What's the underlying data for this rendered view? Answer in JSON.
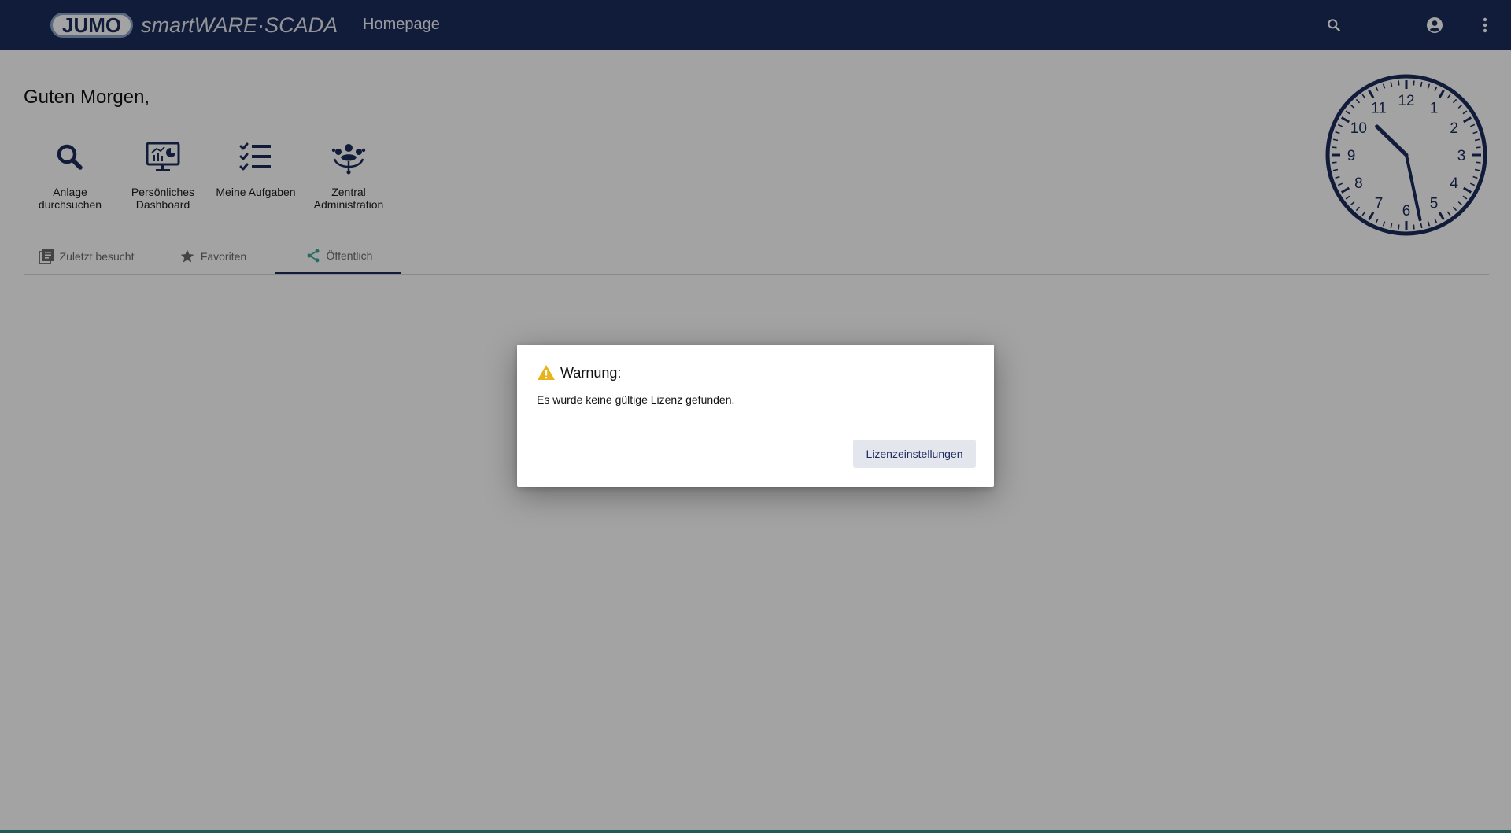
{
  "colors": {
    "topbar": "#1c2c5c",
    "accent": "#1c2c5c",
    "tab_active_icon": "#3aa89c",
    "warning": "#e8b31b",
    "overlay": "rgba(0,0,0,0.36)"
  },
  "header": {
    "brand": "JUMO",
    "product": "smartWARE·SCADA",
    "page_name": "Homepage",
    "icons": [
      "search-icon",
      "account-icon",
      "more-vert-icon"
    ]
  },
  "home": {
    "greeting": "Guten Morgen,",
    "quick_links": [
      {
        "label": "Anlage durchsuchen",
        "icon": "search-icon"
      },
      {
        "label": "Persönliches Dashboard",
        "icon": "dashboard-monitor-icon"
      },
      {
        "label": "Meine Aufgaben",
        "icon": "task-list-icon"
      },
      {
        "label": "Zentral Administration",
        "icon": "admin-hub-icon"
      }
    ],
    "tabs": [
      {
        "label": "Zuletzt besucht",
        "icon": "history-icon",
        "active": false
      },
      {
        "label": "Favoriten",
        "icon": "star-icon",
        "active": false
      },
      {
        "label": "Öffentlich",
        "icon": "share-icon",
        "active": true
      }
    ]
  },
  "clock": {
    "numbers": [
      "12",
      "1",
      "2",
      "3",
      "4",
      "5",
      "6",
      "7",
      "8",
      "9",
      "10",
      "11"
    ],
    "hour": 10,
    "minute": 28
  },
  "dialog": {
    "title": "Warnung:",
    "message": "Es wurde keine gültige Lizenz gefunden.",
    "button_label": "Lizenzeinstellungen"
  }
}
